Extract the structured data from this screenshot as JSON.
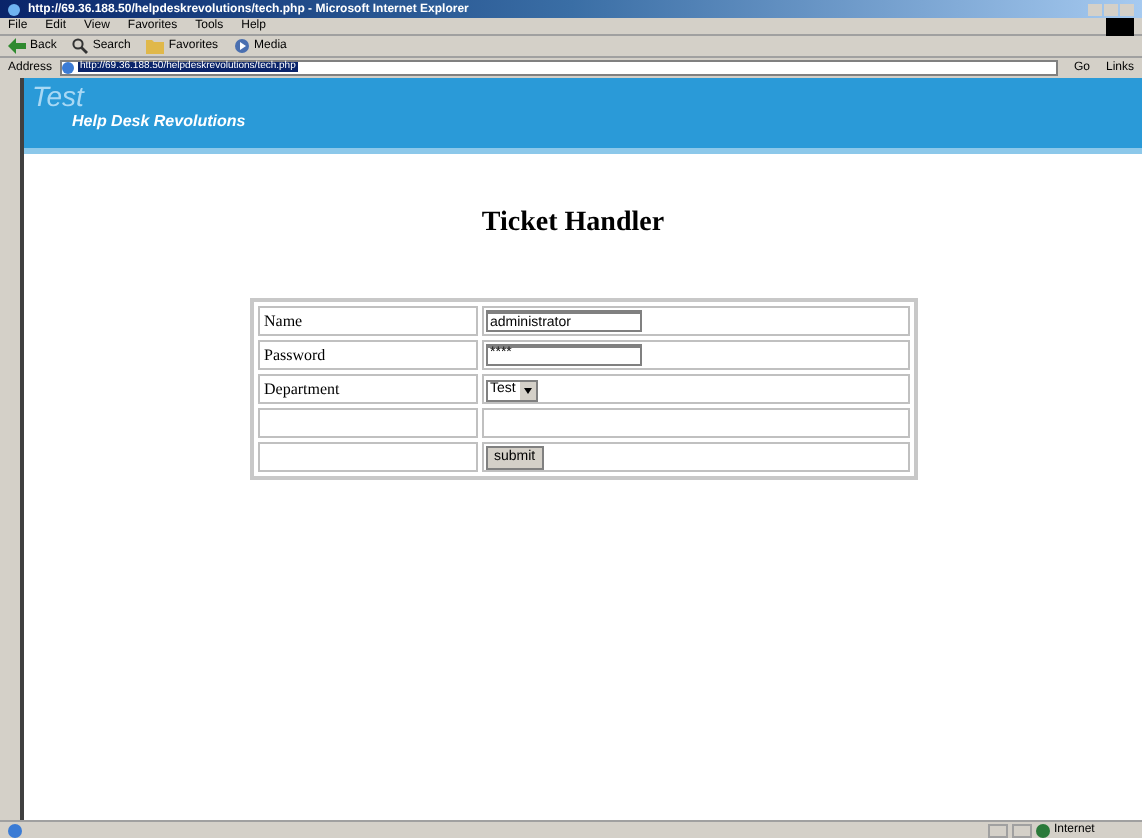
{
  "window": {
    "title": "http://69.36.188.50/helpdeskrevolutions/tech.php - Microsoft Internet Explorer"
  },
  "menu": [
    "File",
    "Edit",
    "View",
    "Favorites",
    "Tools",
    "Help"
  ],
  "toolbar": [
    {
      "kind": "back",
      "label": "Back"
    },
    {
      "kind": "search",
      "label": "Search"
    },
    {
      "kind": "favorites",
      "label": "Favorites"
    },
    {
      "kind": "media",
      "label": "Media"
    }
  ],
  "address": {
    "label": "Address",
    "url": "http://69.36.188.50/helpdeskrevolutions/tech.php",
    "go": "Go",
    "links": "Links"
  },
  "banner": {
    "title": "Test",
    "subtitle": "Help Desk Revolutions"
  },
  "heading": "Ticket Handler",
  "form": {
    "rows": [
      {
        "kind": "text",
        "label": "Name",
        "value": "administrator"
      },
      {
        "kind": "password",
        "label": "Password",
        "value": "****"
      },
      {
        "kind": "select",
        "label": "Department",
        "value": "Test"
      },
      {
        "kind": "empty"
      },
      {
        "kind": "button",
        "value": "submit"
      }
    ]
  },
  "status_bar": {
    "zone": "Internet"
  }
}
